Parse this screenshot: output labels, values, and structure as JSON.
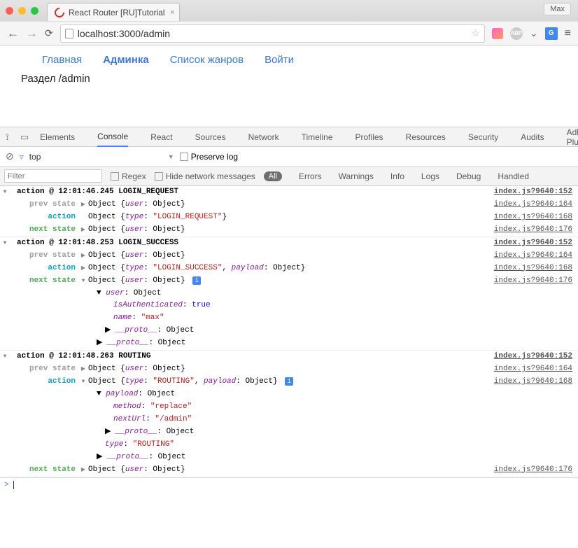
{
  "browser": {
    "tab_title": "React Router [RU]Tutorial",
    "user_badge": "Max",
    "url_prefix": "localhost",
    "url_port_path": ":3000/admin"
  },
  "nav": {
    "items": [
      "Главная",
      "Админка",
      "Список жанров",
      "Войти"
    ],
    "active_index": 1
  },
  "page_body": "Раздел /admin",
  "devtools": {
    "tabs": [
      "Elements",
      "Console",
      "React",
      "Sources",
      "Network",
      "Timeline",
      "Profiles",
      "Resources",
      "Security",
      "Audits",
      "Adblock Plus"
    ],
    "active_tab_index": 1,
    "context": "top",
    "preserve_log_label": "Preserve log",
    "filter_placeholder": "Filter",
    "regex_label": "Regex",
    "hide_net_label": "Hide network messages",
    "levels": [
      "All",
      "Errors",
      "Warnings",
      "Info",
      "Logs",
      "Debug",
      "Handled"
    ]
  },
  "logs": [
    {
      "header": "action @ 12:01:46.245 LOGIN_REQUEST",
      "src": "index.js?9640:152",
      "entries": [
        {
          "label": "prev state",
          "src": "index.js?9640:164",
          "expand": "closed",
          "lines": [
            "Object {<k>user</k>: Object}"
          ]
        },
        {
          "label": "action",
          "src": "index.js?9640:168",
          "expand": "none",
          "lines": [
            "Object {<k>type</k>: <s>\"LOGIN_REQUEST\"</s>}"
          ]
        },
        {
          "label": "next state",
          "src": "index.js?9640:176",
          "expand": "closed",
          "lines": [
            "Object {<k>user</k>: Object}"
          ]
        }
      ]
    },
    {
      "header": "action @ 12:01:48.253 LOGIN_SUCCESS",
      "src": "index.js?9640:152",
      "entries": [
        {
          "label": "prev state",
          "src": "index.js?9640:164",
          "expand": "closed",
          "lines": [
            "Object {<k>user</k>: Object}"
          ]
        },
        {
          "label": "action",
          "src": "index.js?9640:168",
          "expand": "closed",
          "lines": [
            "Object {<k>type</k>: <s>\"LOGIN_SUCCESS\"</s>, <k>payload</k>: Object}"
          ]
        },
        {
          "label": "next state",
          "src": "index.js?9640:176",
          "expand": "open",
          "lines": [
            "Object {<k>user</k>: Object} <i></i>",
            "  ▼ <k>user</k>: Object",
            "      <k>isAuthenticated</k>: <b>true</b>",
            "      <k>name</k>: <s>\"max\"</s>",
            "    ▶ <k>__proto__</k>: Object",
            "  ▶ <k>__proto__</k>: Object"
          ]
        }
      ]
    },
    {
      "header": "action @ 12:01:48.263 ROUTING",
      "src": "index.js?9640:152",
      "entries": [
        {
          "label": "prev state",
          "src": "index.js?9640:164",
          "expand": "closed",
          "lines": [
            "Object {<k>user</k>: Object}"
          ]
        },
        {
          "label": "action",
          "src": "index.js?9640:168",
          "expand": "open",
          "lines": [
            "Object {<k>type</k>: <s>\"ROUTING\"</s>, <k>payload</k>: Object} <i></i>",
            "  ▼ <k>payload</k>: Object",
            "      <k>method</k>: <s>\"replace\"</s>",
            "      <k>nextUrl</k>: <s>\"/admin\"</s>",
            "    ▶ <k>__proto__</k>: Object",
            "    <k>type</k>: <s>\"ROUTING\"</s>",
            "  ▶ <k>__proto__</k>: Object"
          ]
        },
        {
          "label": "next state",
          "src": "index.js?9640:176",
          "expand": "closed",
          "lines": [
            "Object {<k>user</k>: Object}"
          ]
        }
      ]
    }
  ]
}
